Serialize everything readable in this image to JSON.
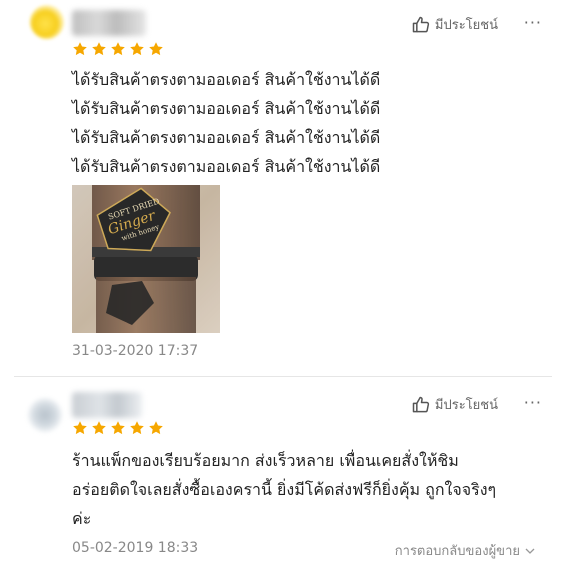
{
  "reviews": [
    {
      "rating": 5,
      "helpful_label": "มีประโยชน์",
      "more_label": "···",
      "text_lines": [
        "ได้รับสินค้าตรงตามออเดอร์ สินค้าใช้งานได้ดี",
        "ได้รับสินค้าตรงตามออเดอร์ สินค้าใช้งานได้ดี",
        "ได้รับสินค้าตรงตามออเดอร์ สินค้าใช้งานได้ดี",
        "ได้รับสินค้าตรงตามออเดอร์ สินค้าใช้งานได้ดี"
      ],
      "photo": {
        "label_line1": "SOFT DRIED",
        "label_line2": "Ginger",
        "label_line3": "with honey"
      },
      "date": "31-03-2020 17:37"
    },
    {
      "rating": 5,
      "helpful_label": "มีประโยชน์",
      "more_label": "···",
      "text_lines": [
        "ร้านแพ็กของเรียบร้อยมาก ส่งเร็วหลาย เพื่อนเคยสั่งให้ชิม",
        "อร่อยติดใจเลยสั่งซื้อเองครานี้ ยิ่งมีโค้ดส่งฟรีก็ยิ่งคุ้ม ถูกใจจริงๆ",
        "ค่ะ"
      ],
      "date": "05-02-2019 18:33",
      "seller_reply_label": "การตอบกลับของผู้ขาย"
    }
  ],
  "colors": {
    "star": "#f6a700",
    "meta_text": "#888888",
    "divider": "#e6e6e6"
  }
}
